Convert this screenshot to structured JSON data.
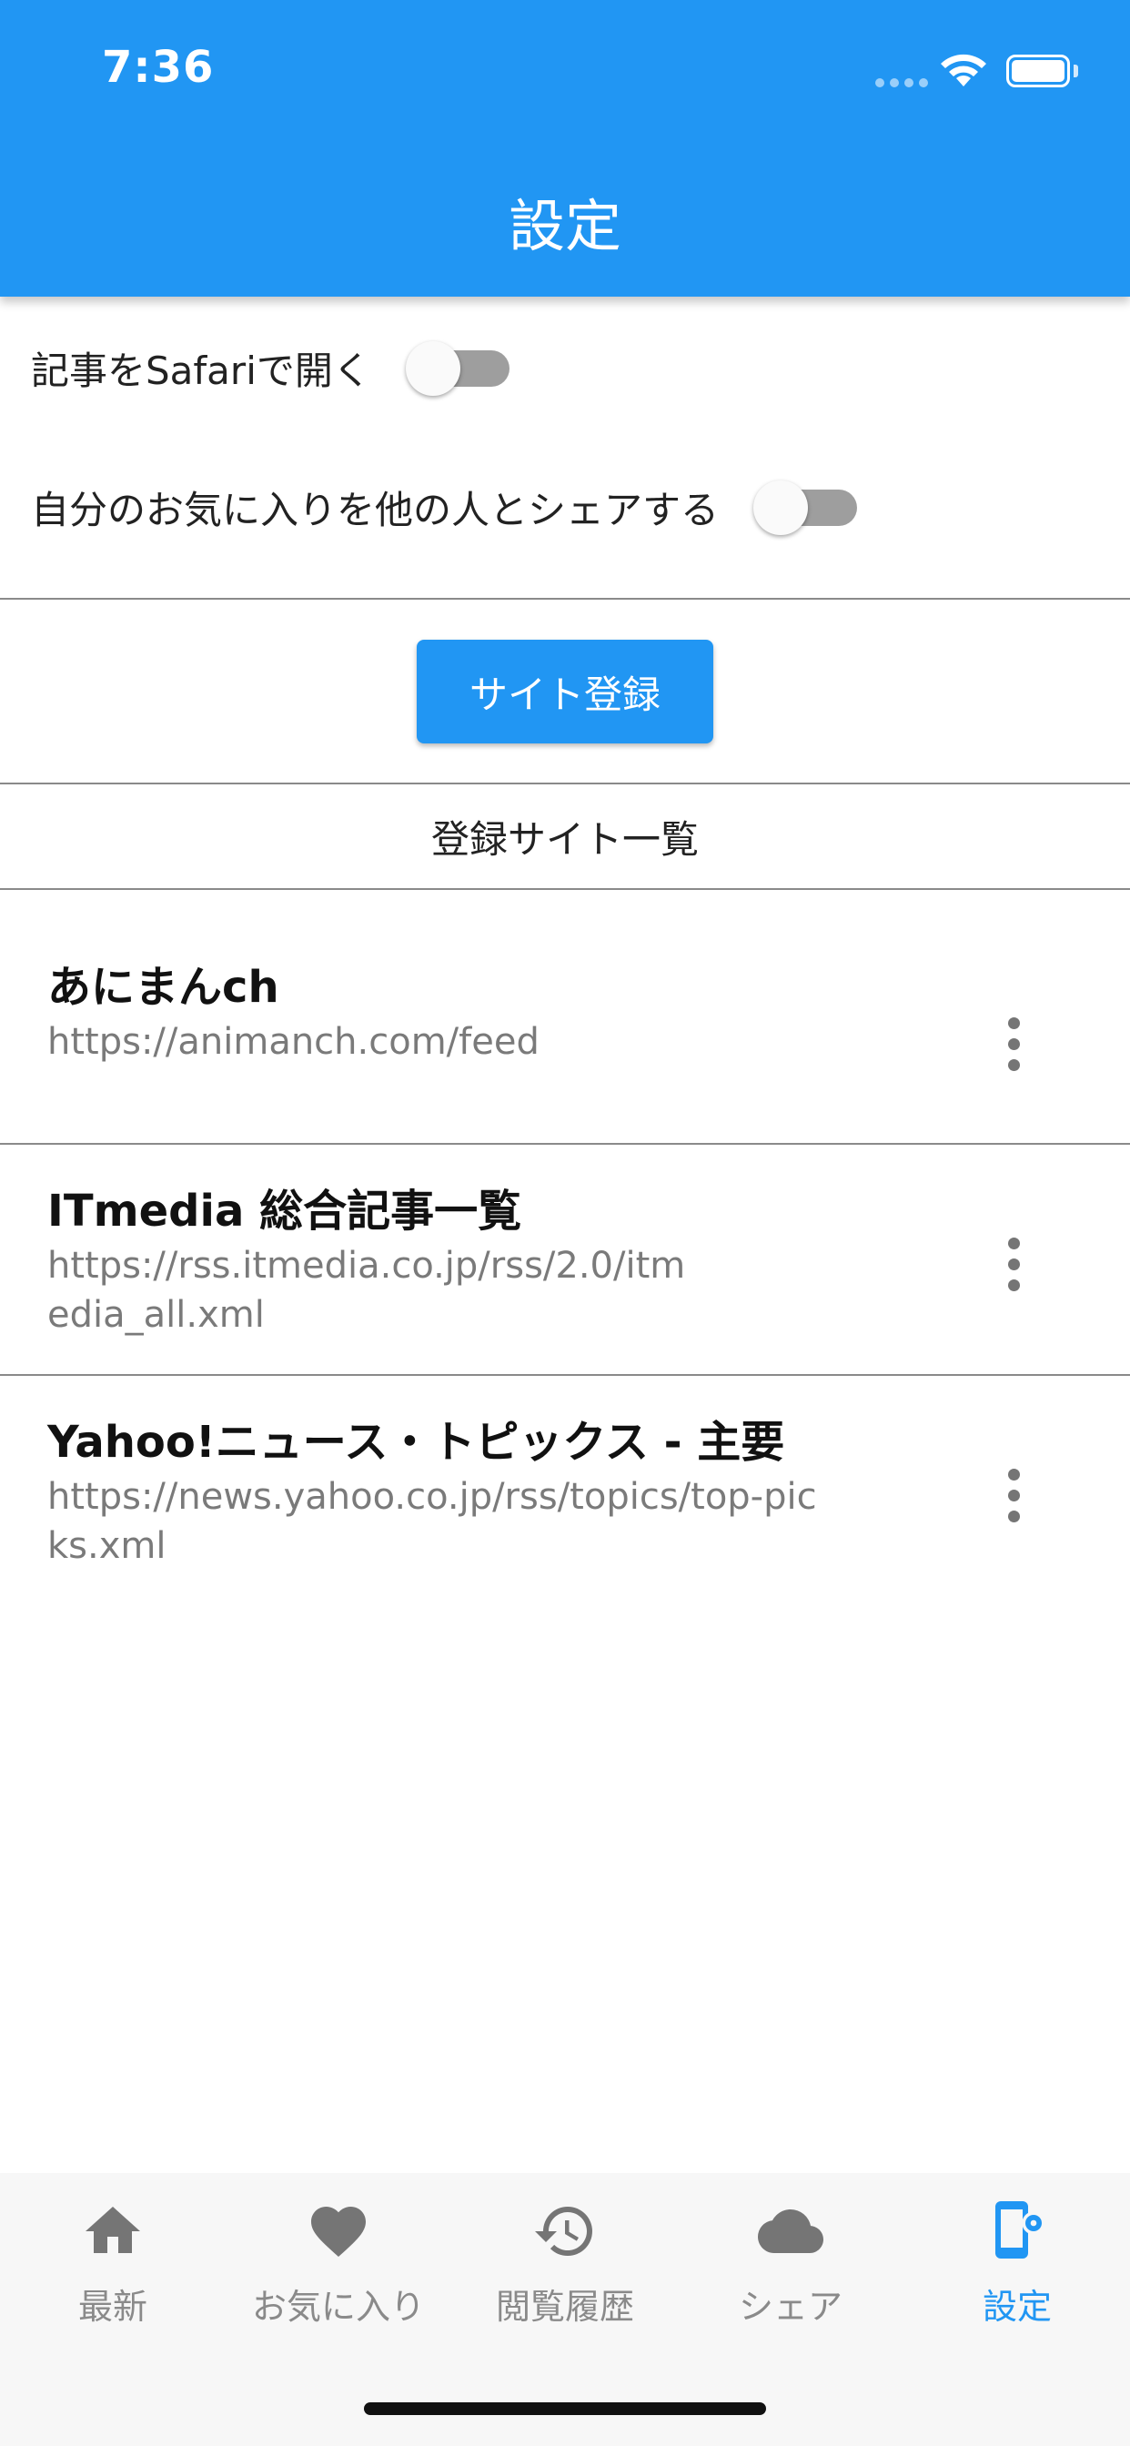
{
  "status_bar": {
    "time": "7:36"
  },
  "header": {
    "title": "設定"
  },
  "settings": {
    "open_in_safari": {
      "label": "記事をSafariで開く",
      "enabled": false
    },
    "share_favorites": {
      "label": "自分のお気に入りを他の人とシェアする",
      "enabled": false
    }
  },
  "register_button": {
    "label": "サイト登録"
  },
  "sites": {
    "header": "登録サイト一覧",
    "items": [
      {
        "title": "あにまんch",
        "url": "https://animanch.com/feed"
      },
      {
        "title": "ITmedia 総合記事一覧",
        "url": "https://rss.itmedia.co.jp/rss/2.0/itmedia_all.xml"
      },
      {
        "title": "Yahoo!ニュース・トピックス - 主要",
        "url": "https://news.yahoo.co.jp/rss/topics/top-picks.xml"
      }
    ]
  },
  "bottom_nav": {
    "items": [
      {
        "label": "最新",
        "icon": "home-icon",
        "active": false
      },
      {
        "label": "お気に入り",
        "icon": "heart-icon",
        "active": false
      },
      {
        "label": "閲覧履歴",
        "icon": "history-icon",
        "active": false
      },
      {
        "label": "シェア",
        "icon": "cloud-icon",
        "active": false
      },
      {
        "label": "設定",
        "icon": "settings-phone-icon",
        "active": true
      }
    ]
  },
  "colors": {
    "primary": "#2196F3",
    "inactive_nav": "#8a8a8a",
    "url_text": "#7a7a7a"
  }
}
